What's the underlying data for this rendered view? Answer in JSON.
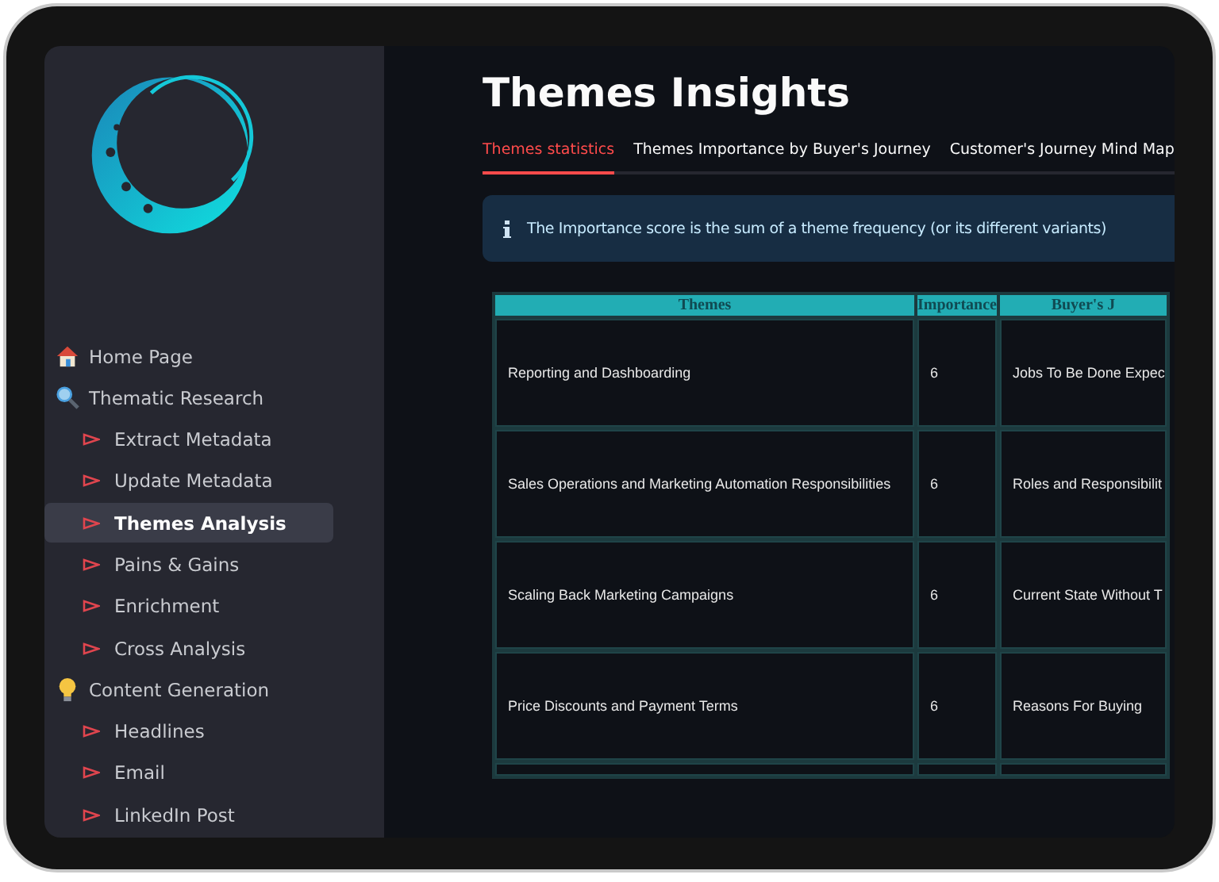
{
  "sidebar": {
    "items": [
      {
        "label": "Home Page",
        "kind": "home",
        "selected": false
      },
      {
        "label": "Thematic Research",
        "kind": "search",
        "selected": false,
        "children": [
          {
            "label": "Extract Metadata",
            "kind": "page",
            "selected": false
          },
          {
            "label": "Update Metadata",
            "kind": "page",
            "selected": false
          },
          {
            "label": "Themes Analysis",
            "kind": "page",
            "selected": true
          },
          {
            "label": "Pains & Gains",
            "kind": "page",
            "selected": false
          },
          {
            "label": "Enrichment",
            "kind": "page",
            "selected": false
          },
          {
            "label": "Cross Analysis",
            "kind": "page",
            "selected": false
          }
        ]
      },
      {
        "label": "Content Generation",
        "kind": "idea",
        "selected": false,
        "children": [
          {
            "label": "Headlines",
            "kind": "page",
            "selected": false
          },
          {
            "label": "Email",
            "kind": "page",
            "selected": false
          },
          {
            "label": "LinkedIn Post",
            "kind": "page",
            "selected": false
          }
        ]
      }
    ]
  },
  "title": "Themes Insights",
  "tabs": [
    {
      "label": "Themes statistics",
      "selected": true
    },
    {
      "label": "Themes Importance by Buyer's Journey",
      "selected": false
    },
    {
      "label": "Customer's Journey Mind Map",
      "selected": false
    }
  ],
  "info": "The Importance score is the sum of a theme frequency (or its different variants)",
  "table": {
    "columns": [
      "Themes",
      "Importance",
      "Buyer's J"
    ],
    "rows": [
      [
        "Reporting and Dashboarding",
        "6",
        "Jobs To Be Done Expec"
      ],
      [
        "Sales Operations and Marketing Automation Responsibilities",
        "6",
        "Roles and Responsibilit"
      ],
      [
        "Scaling Back Marketing Campaigns",
        "6",
        "Current State Without T"
      ],
      [
        "Price Discounts and Payment Terms",
        "6",
        "Reasons For Buying"
      ]
    ]
  }
}
